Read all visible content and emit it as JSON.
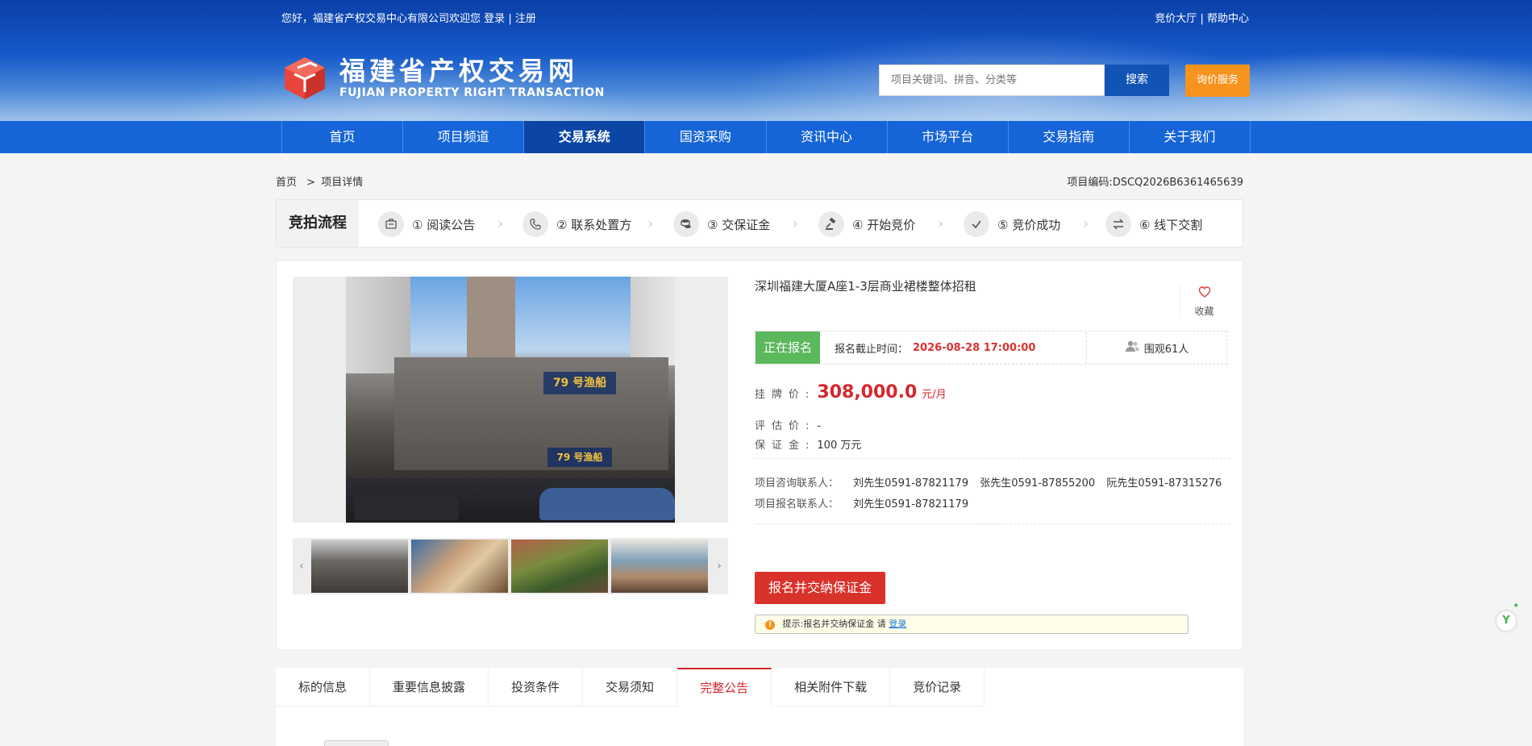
{
  "topbar": {
    "welcome": "您好，福建省产权交易中心有限公司欢迎您",
    "login": "登录",
    "sep": "|",
    "register": "注册",
    "right_link1": "竞价大厅",
    "right_link2": "帮助中心"
  },
  "logo": {
    "cn": "福建省产权交易网",
    "en": "FUJIAN PROPERTY RIGHT TRANSACTION"
  },
  "search": {
    "placeholder": "项目关键词、拼音、分类等",
    "button": "搜索",
    "inquiry": "询价服务"
  },
  "nav": [
    "首页",
    "项目频道",
    "交易系统",
    "国资采购",
    "资讯中心",
    "市场平台",
    "交易指南",
    "关于我们"
  ],
  "nav_active_index": 2,
  "breadcrumb": {
    "home": "首页",
    "sep": ">",
    "current": "项目详情"
  },
  "project_code": "项目编码:DSCQ2026B6361465639",
  "process": {
    "title": "竞拍流程",
    "steps": [
      {
        "label": "① 阅读公告",
        "icon": "notice-icon"
      },
      {
        "label": "② 联系处置方",
        "icon": "phone-icon"
      },
      {
        "label": "③ 交保证金",
        "icon": "coins-icon"
      },
      {
        "label": "④ 开始竞价",
        "icon": "gavel-icon"
      },
      {
        "label": "⑤ 竞价成功",
        "icon": "check-icon"
      },
      {
        "label": "⑥ 线下交割",
        "icon": "exchange-icon"
      }
    ]
  },
  "project": {
    "title": "深圳福建大厦A座1-3层商业裙楼整体招租",
    "favorite": "收藏",
    "status": "正在报名",
    "deadline_label": "报名截止时间：",
    "deadline": "2026-08-28 17:00:00",
    "views": "围观61人",
    "listing_price_label": "挂牌价",
    "listing_price": "308,000.0",
    "listing_price_unit": "元/月",
    "appraisal_label": "评估价",
    "appraisal_value": "-",
    "deposit_label": "保证金",
    "deposit_value": "100 万元",
    "consult_label": "项目咨询联系人：",
    "consult_contacts": [
      "刘先生0591-87821179",
      "张先生0591-87855200",
      "阮先生0591-87315276"
    ],
    "signup_label": "项目报名联系人：",
    "signup_contact": "刘先生0591-87821179",
    "signup_button": "报名并交纳保证金",
    "tip_text": "提示:报名并交纳保证金 请",
    "tip_link": "登录",
    "photo_sign": "79 号渔船",
    "photo_sign2": "79 号渔船"
  },
  "tabs": [
    "标的信息",
    "重要信息披露",
    "投资条件",
    "交易须知",
    "完整公告",
    "相关附件下载",
    "竞价记录"
  ],
  "tabs_active_index": 4,
  "colors": {
    "nav_blue": "#1565d8",
    "price_red": "#d7262b",
    "status_green": "#5cb85c",
    "inquiry_orange": "#f7931e"
  }
}
